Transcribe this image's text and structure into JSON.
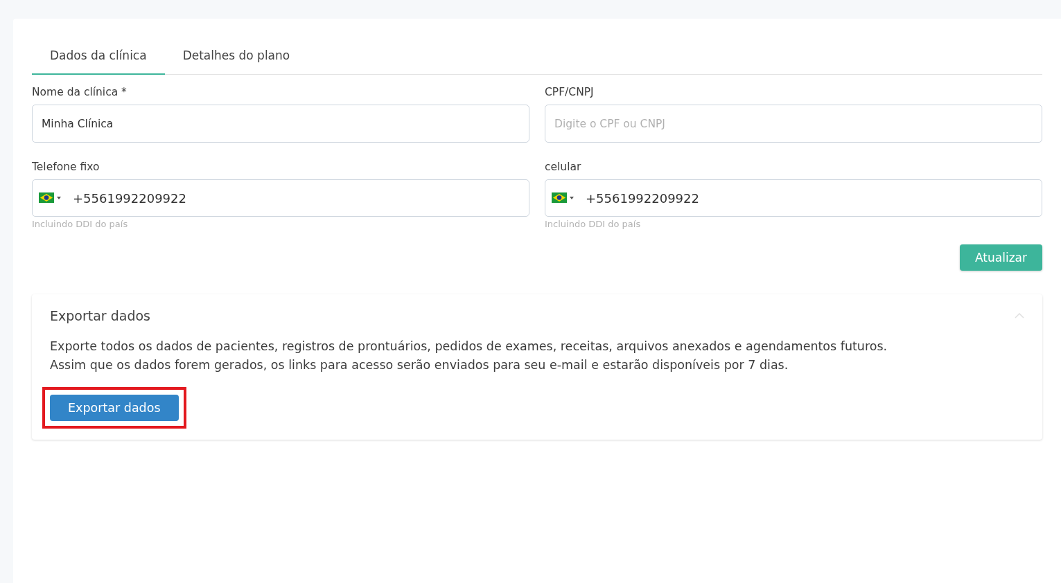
{
  "tabs": [
    {
      "label": "Dados da clínica",
      "selected": true
    },
    {
      "label": "Detalhes do plano",
      "selected": false
    }
  ],
  "fields": [
    {
      "kind": "text",
      "label": "Nome da clínica *",
      "value": "Minha Clínica"
    },
    {
      "kind": "text",
      "label": "CPF/CNPJ",
      "placeholder": "Digite o CPF ou CNPJ"
    },
    {
      "kind": "phone",
      "label": "Telefone fixo",
      "value": "+5561992209922",
      "hint": "Incluindo DDI do país"
    },
    {
      "kind": "phone",
      "label": "celular",
      "value": "+5561992209922",
      "hint": "Incluindo DDI do país"
    }
  ],
  "update_button": "Atualizar",
  "export_panel": {
    "title": "Exportar dados",
    "expanded": true,
    "description": [
      "Exporte todos os dados de pacientes, registros de prontuários, pedidos de exames, receitas, arquivos anexados e agendamentos futuros.",
      "Assim que os dados forem gerados, os links para acesso serão enviados para seu e-mail e estarão disponíveis por 7 dias."
    ],
    "button": "Exportar dados",
    "highlighted": true
  }
}
